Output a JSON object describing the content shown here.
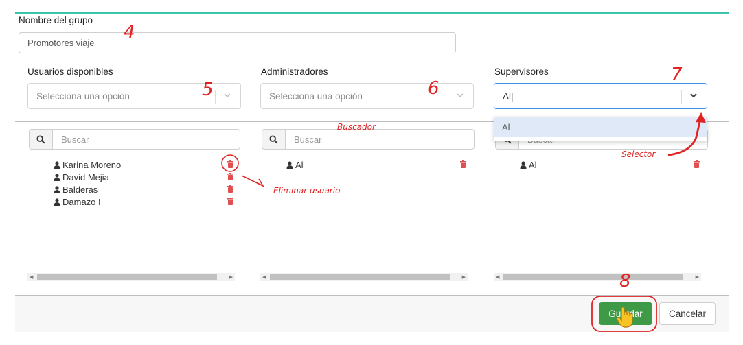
{
  "group_name": {
    "label": "Nombre del grupo",
    "value": "Promotores viaje"
  },
  "columns": [
    {
      "label": "Usuarios disponibles",
      "select_value": "Selecciona una opción",
      "search_placeholder": "Buscar",
      "users": [
        "Karina Moreno",
        "David Mejia",
        "Balderas",
        "Damazo I"
      ]
    },
    {
      "label": "Administradores",
      "select_value": "Selecciona una opción",
      "search_placeholder": "Buscar",
      "users": [
        "Al"
      ]
    },
    {
      "label": "Supervisores",
      "select_value": "Al",
      "search_placeholder": "Buscar",
      "users": [
        "Al"
      ],
      "dropdown_option": "Al"
    }
  ],
  "buttons": {
    "save": "Guardar",
    "cancel": "Cancelar"
  },
  "annotations": {
    "n4": "4",
    "n5": "5",
    "n6": "6",
    "n7": "7",
    "n8": "8",
    "buscador": "Buscador",
    "eliminar": "Eliminar usuario",
    "selector": "Selector"
  },
  "colors": {
    "accent_line": "#3cc3ab",
    "save_btn": "#3f9a47",
    "trash": "#e05050",
    "annotation": "#e02424",
    "focus_border": "#3f8ee6"
  },
  "icons": [
    "search-icon",
    "user-icon",
    "trash-icon",
    "chevron-down-icon",
    "hand-cursor-icon"
  ]
}
